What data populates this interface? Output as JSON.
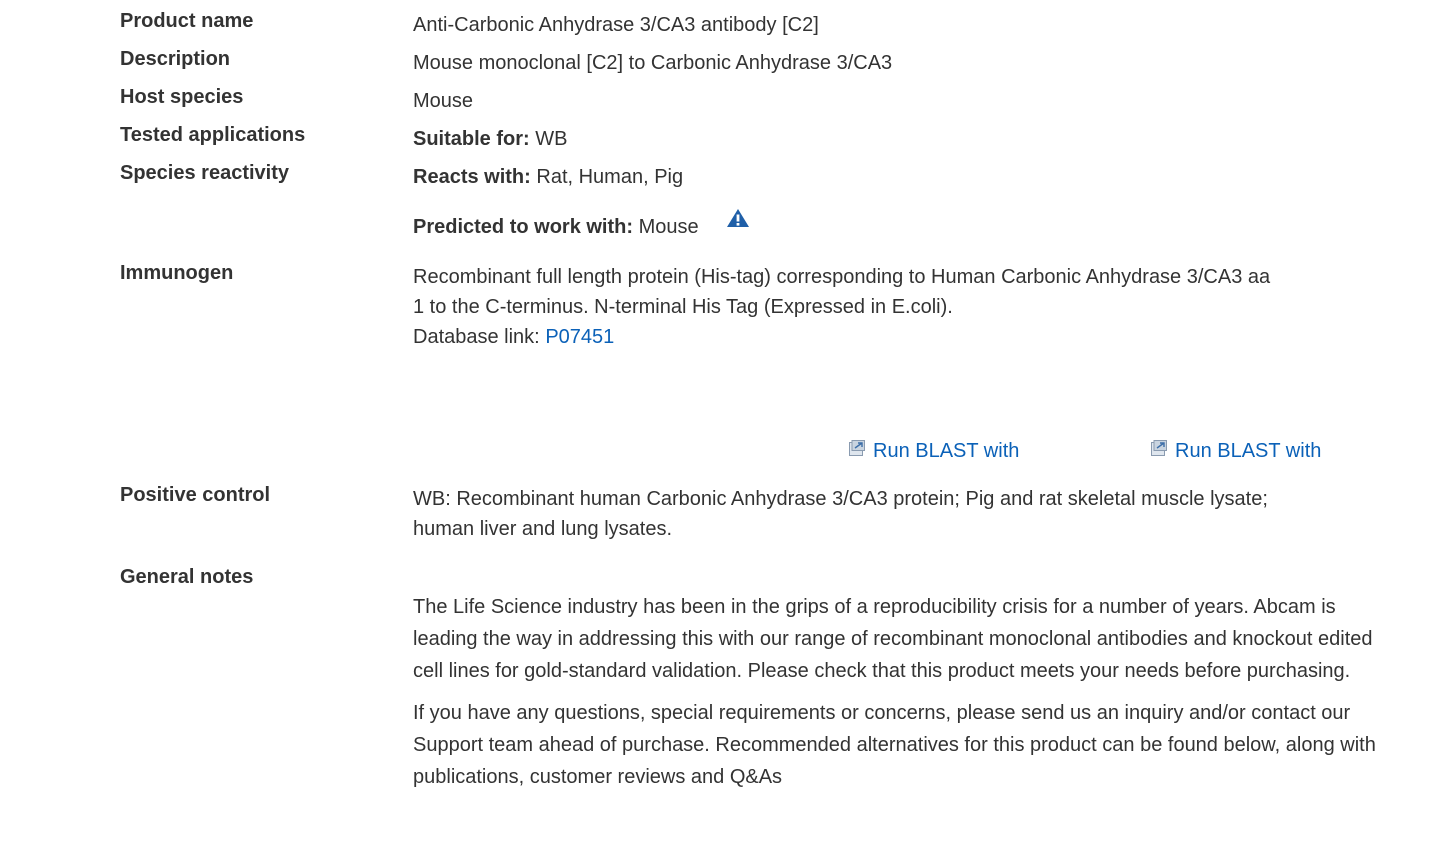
{
  "product_name": {
    "label": "Product name",
    "value": "Anti-Carbonic Anhydrase 3/CA3 antibody [C2]"
  },
  "description": {
    "label": "Description",
    "value": "Mouse monoclonal [C2] to Carbonic Anhydrase 3/CA3"
  },
  "host_species": {
    "label": "Host species",
    "value": "Mouse"
  },
  "tested_applications": {
    "label": "Tested applications",
    "prefix": "Suitable for:",
    "value": "WB"
  },
  "species_reactivity": {
    "label": "Species reactivity",
    "reacts_prefix": "Reacts with:",
    "reacts_value": "Rat, Human, Pig",
    "predicted_prefix": "Predicted to work with:",
    "predicted_value": "Mouse",
    "warning_icon": "warning-icon"
  },
  "immunogen": {
    "label": "Immunogen",
    "line1": "Recombinant full length protein (His-tag) corresponding to Human Carbonic Anhydrase 3/CA3 aa",
    "line2": "1 to the C-terminus. N-terminal His Tag (Expressed in E.coli).",
    "db_prefix": "Database link:",
    "db_link": "P07451",
    "blast_1": "Run BLAST with",
    "blast_2": "Run BLAST with",
    "blast_icon": "external-link-icon"
  },
  "positive_control": {
    "label": "Positive control",
    "line1": "WB: Recombinant human Carbonic Anhydrase 3/CA3 protein; Pig and rat skeletal muscle lysate;",
    "line2": "human liver and lung lysates."
  },
  "general_notes": {
    "label": "General notes",
    "para1": "The Life Science industry has been in the grips of a reproducibility crisis for a number of years. Abcam is leading the way in addressing this with our range of recombinant monoclonal antibodies and knockout edited cell lines for gold-standard validation. Please check that this product meets your needs before purchasing.",
    "para2": "If you have any questions, special requirements or concerns, please send us an inquiry and/or contact our Support team ahead of purchase. Recommended alternatives for this product can be found below, along with publications, customer reviews and Q&As"
  },
  "colors": {
    "text": "#333333",
    "link": "#0b61b8",
    "warning_icon": "#1f5fa8"
  }
}
